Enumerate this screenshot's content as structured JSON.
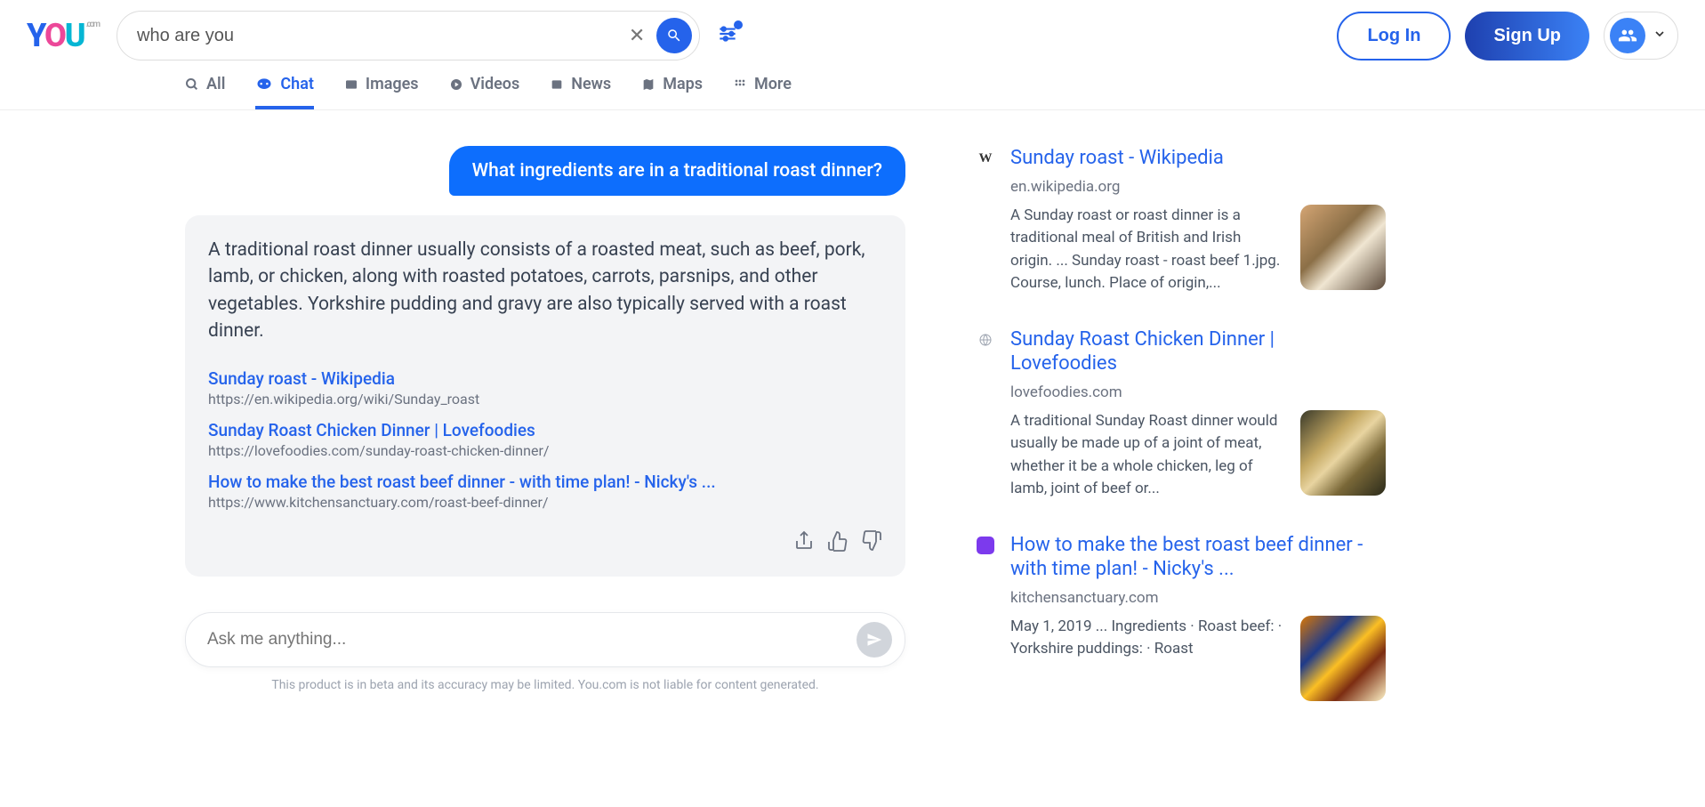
{
  "search": {
    "value": "who are you"
  },
  "header": {
    "login": "Log In",
    "signup": "Sign Up"
  },
  "tabs": {
    "all": "All",
    "chat": "Chat",
    "images": "Images",
    "videos": "Videos",
    "news": "News",
    "maps": "Maps",
    "more": "More"
  },
  "chat": {
    "user_message": "What ingredients are in a traditional roast dinner?",
    "bot_message": "A traditional roast dinner usually consists of a roasted meat, such as beef, pork, lamb, or chicken, along with roasted potatoes, carrots, parsnips, and other vegetables. Yorkshire pudding and gravy are also typically served with a roast dinner.",
    "sources": [
      {
        "title": "Sunday roast - Wikipedia",
        "url": "https://en.wikipedia.org/wiki/Sunday_roast"
      },
      {
        "title": "Sunday Roast Chicken Dinner | Lovefoodies",
        "url": "https://lovefoodies.com/sunday-roast-chicken-dinner/"
      },
      {
        "title": "How to make the best roast beef dinner - with time plan! - Nicky's ...",
        "url": "https://www.kitchensanctuary.com/roast-beef-dinner/"
      }
    ],
    "input_placeholder": "Ask me anything...",
    "disclaimer": "This product is in beta and its accuracy may be limited. You.com is not liable for content generated."
  },
  "results": [
    {
      "title": "Sunday roast - Wikipedia",
      "domain": "en.wikipedia.org",
      "snippet": "A Sunday roast or roast dinner is a traditional meal of British and Irish origin. ... Sunday roast - roast beef 1.jpg. Course, lunch. Place of origin,..."
    },
    {
      "title": "Sunday Roast Chicken Dinner | Lovefoodies",
      "domain": "lovefoodies.com",
      "snippet": "A traditional Sunday Roast dinner would usually be made up of a joint of meat, whether it be a whole chicken, leg of lamb, joint of beef or..."
    },
    {
      "title": "How to make the best roast beef dinner - with time plan! - Nicky's ...",
      "domain": "kitchensanctuary.com",
      "snippet": "May 1, 2019 ... Ingredients · Roast beef: · Yorkshire puddings: · Roast"
    }
  ]
}
